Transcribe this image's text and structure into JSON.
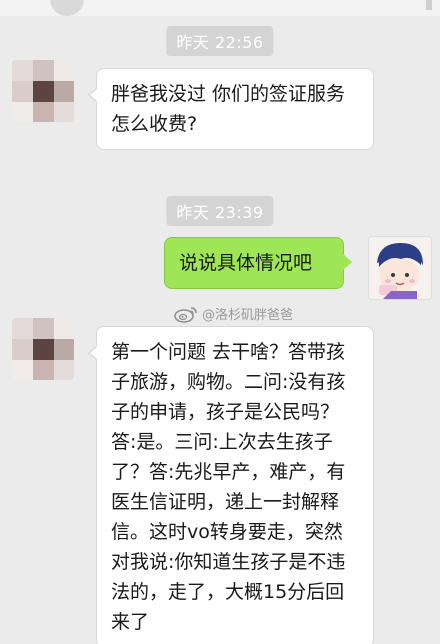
{
  "conversation": {
    "timestamp_1": "昨天 22:56",
    "timestamp_2": "昨天 23:39",
    "messages": [
      {
        "sender": "other",
        "text": "胖爸我没过 你们的签证服务怎么收费?"
      },
      {
        "sender": "me",
        "text": "说说具体情况吧"
      },
      {
        "sender": "other",
        "text": "第一个问题 去干啥？答带孩子旅游，购物。二问:没有孩子的申请，孩子是公民吗？答:是。三问:上次去生孩子了？答:先兆早产，难产，有医生信证明，递上一封解释信。这时vo转身要走，突然对我说:你知道生孩子是不违法的，走了，大概15分后回来了"
      }
    ]
  },
  "watermark": {
    "text": "@洛杉矶胖爸爸",
    "icon": "weibo-icon"
  },
  "colors": {
    "background": "#ebebeb",
    "sent_bubble": "#9ee655",
    "received_bubble": "#ffffff",
    "timestamp_badge": "#d4d4d4"
  }
}
